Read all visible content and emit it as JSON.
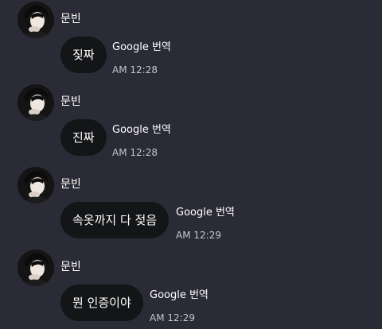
{
  "messages": [
    {
      "sender": "문빈",
      "text": "짖짜",
      "translate_label": "Google 번역",
      "time": "AM 12:28"
    },
    {
      "sender": "문빈",
      "text": "진짜",
      "translate_label": "Google 번역",
      "time": "AM 12:28"
    },
    {
      "sender": "문빈",
      "text": "속옷까지 다 젖음",
      "translate_label": "Google 번역",
      "time": "AM 12:29"
    },
    {
      "sender": "문빈",
      "text": "뭔 인증이야",
      "translate_label": "Google 번역",
      "time": "AM 12:29"
    }
  ]
}
